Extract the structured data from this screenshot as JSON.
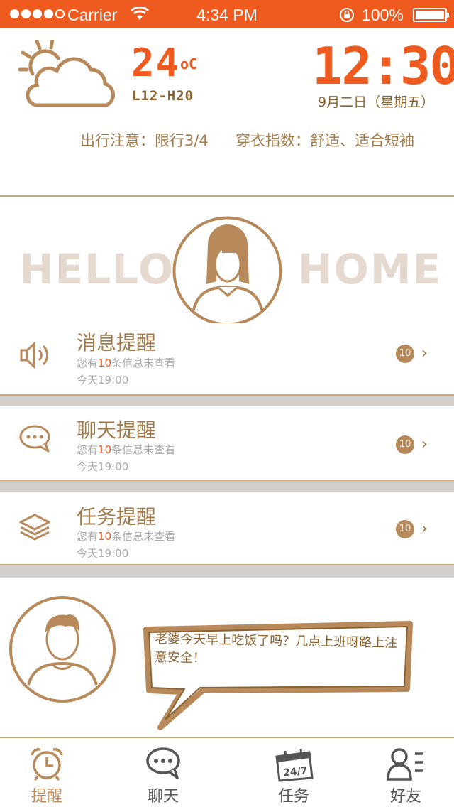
{
  "status_bar": {
    "carrier": "Carrier",
    "time": "4:34 PM",
    "battery": "100%"
  },
  "weather": {
    "temperature": "24",
    "unit": "oC",
    "range": "L12-H20",
    "icon": "partly-cloudy-icon"
  },
  "clock": {
    "time": "12:30",
    "date": "9月二日（星期五）"
  },
  "tips": {
    "travel": "出行注意：限行3/4",
    "clothing": "穿衣指数：舒适、适合短袖"
  },
  "hero": {
    "left_text": "HELLO",
    "right_text": "HOME"
  },
  "cards": [
    {
      "title": "消息提醒",
      "sub_pre": "您有",
      "sub_num": "10",
      "sub_post": "条信息未查看",
      "time": "今天19:00",
      "badge": "10",
      "icon": "speaker-icon"
    },
    {
      "title": "聊天提醒",
      "sub_pre": "您有",
      "sub_num": "10",
      "sub_post": "条信息未查看",
      "time": "今天19:00",
      "badge": "10",
      "icon": "chat-bubble-icon"
    },
    {
      "title": "任务提醒",
      "sub_pre": "您有",
      "sub_num": "10",
      "sub_post": "条信息未查看",
      "time": "今天19:00",
      "badge": "10",
      "icon": "layers-icon"
    }
  ],
  "message": {
    "text": "老婆今天早上吃饭了吗？几点上班呀路上注意安全！"
  },
  "tabs": [
    {
      "label": "提醒",
      "icon": "alarm-clock-icon",
      "active": true
    },
    {
      "label": "聊天",
      "icon": "chat-icon",
      "active": false
    },
    {
      "label": "任务",
      "icon": "calendar-24-7-icon",
      "active": false
    },
    {
      "label": "好友",
      "icon": "contacts-icon",
      "active": false
    }
  ],
  "colors": {
    "accent": "#ef5a1e",
    "brown": "#a07a4a",
    "hero_text": "#e6dad0",
    "active_tab": "#b8895a",
    "inactive_tab": "#555555"
  }
}
